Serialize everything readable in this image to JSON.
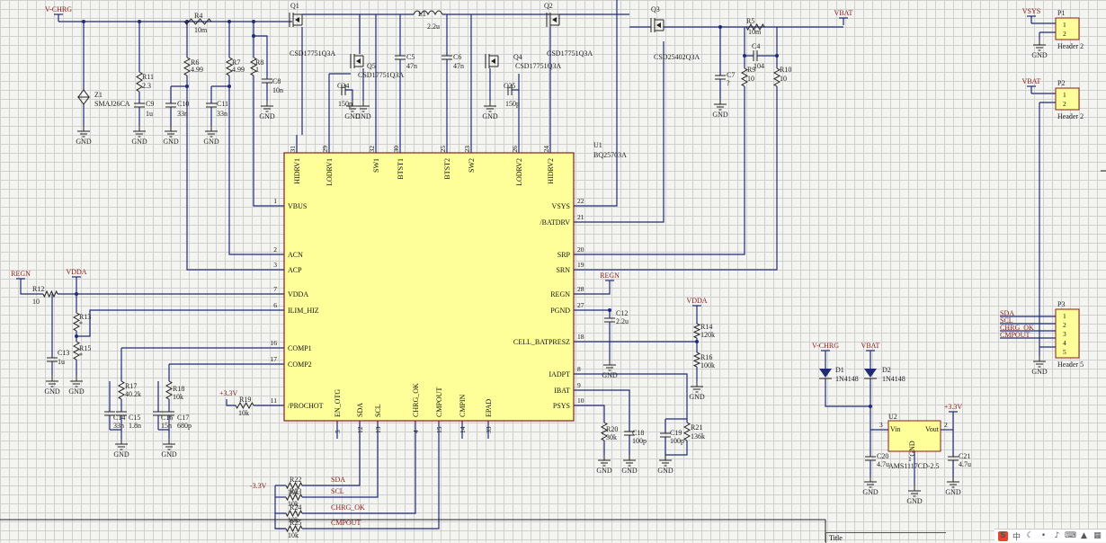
{
  "nets": {
    "vchrg": "V-CHRG",
    "vbat": "VBAT",
    "vsys": "VSYS",
    "regn": "REGN",
    "vdda": "VDDA",
    "v33": "+3.3V",
    "v33neg": "-3.3V",
    "gnd": "GND",
    "sda": "SDA",
    "scl": "SCL",
    "chrg_ok": "CHRG_OK",
    "cmpout": "CMPOUT"
  },
  "ic": {
    "designator": "U1",
    "part": "BQ25703A",
    "top_pins": [
      {
        "num": "31",
        "name": "HIDRV1"
      },
      {
        "num": "29",
        "name": "LODRV1"
      },
      {
        "num": "32",
        "name": "SW1"
      },
      {
        "num": "30",
        "name": "BTST1"
      },
      {
        "num": "25",
        "name": "BTST2"
      },
      {
        "num": "23",
        "name": "SW2"
      },
      {
        "num": "26",
        "name": "LODRV2"
      },
      {
        "num": "24",
        "name": "HIDRV2"
      }
    ],
    "left_pins": [
      {
        "num": "1",
        "name": "VBUS"
      },
      {
        "num": "2",
        "name": "ACN"
      },
      {
        "num": "3",
        "name": "ACP"
      },
      {
        "num": "7",
        "name": "VDDA"
      },
      {
        "num": "6",
        "name": "ILIM_HIZ"
      },
      {
        "num": "16",
        "name": "COMP1"
      },
      {
        "num": "17",
        "name": "COMP2"
      },
      {
        "num": "11",
        "name": "/PROCHOT"
      }
    ],
    "right_pins": [
      {
        "num": "22",
        "name": "VSYS"
      },
      {
        "num": "21",
        "name": "/BATDRV"
      },
      {
        "num": "20",
        "name": "SRP"
      },
      {
        "num": "19",
        "name": "SRN"
      },
      {
        "num": "28",
        "name": "REGN"
      },
      {
        "num": "27",
        "name": "PGND"
      },
      {
        "num": "18",
        "name": "CELL_BATPRESZ"
      },
      {
        "num": "8",
        "name": "IADPT"
      },
      {
        "num": "9",
        "name": "IBAT"
      },
      {
        "num": "10",
        "name": "PSYS"
      }
    ],
    "bottom_pins": [
      {
        "num": "5",
        "name": "EN_OTG"
      },
      {
        "num": "12",
        "name": "SDA"
      },
      {
        "num": "13",
        "name": "SCL"
      },
      {
        "num": "4",
        "name": "CHRG_OK"
      },
      {
        "num": "15",
        "name": "CMPOUT"
      },
      {
        "num": "14",
        "name": "CMPIN"
      },
      {
        "num": "33",
        "name": "EPAD"
      }
    ]
  },
  "components": {
    "q1": {
      "ref": "Q1",
      "val": "CSD17751Q3A"
    },
    "q2": {
      "ref": "Q2",
      "val": "CSD17751Q3A"
    },
    "q3": {
      "ref": "Q3",
      "val": "CSD25402Q3A"
    },
    "q4": {
      "ref": "Q4",
      "val": "CSD17751Q3A"
    },
    "q5": {
      "ref": "Q5",
      "val": "CSD17751Q3A"
    },
    "l1": {
      "ref": "L1",
      "val": "2.2u"
    },
    "r4": {
      "ref": "R4",
      "val": "10m"
    },
    "r5": {
      "ref": "R5",
      "val": "10m"
    },
    "z1": {
      "ref": "Z1",
      "val": "SMAJ26CA"
    },
    "r11": {
      "ref": "R11",
      "val": "2.3"
    },
    "c9": {
      "ref": "C9",
      "val": "1u"
    },
    "r6": {
      "ref": "R6",
      "val": "4.99"
    },
    "c10": {
      "ref": "C10",
      "val": "33n"
    },
    "r7": {
      "ref": "R7",
      "val": "4.99"
    },
    "c11": {
      "ref": "C11",
      "val": "33n"
    },
    "r8": {
      "ref": "R8",
      "val": "1"
    },
    "c8": {
      "ref": "C8",
      "val": "10n"
    },
    "c5": {
      "ref": "C5",
      "val": "47n"
    },
    "c6": {
      "ref": "C6",
      "val": "47n"
    },
    "c24": {
      "ref": "C24",
      "val": "150p"
    },
    "c25": {
      "ref": "C25",
      "val": "150p"
    },
    "c4": {
      "ref": "C4",
      "val": "104"
    },
    "c7": {
      "ref": "C7",
      "val": "?"
    },
    "r9": {
      "ref": "R9",
      "val": "10"
    },
    "r10": {
      "ref": "R10",
      "val": "10"
    },
    "r12": {
      "ref": "R12",
      "val": "10"
    },
    "r13": {
      "ref": "R13",
      "val": "*"
    },
    "r15": {
      "ref": "R15",
      "val": "*"
    },
    "c13": {
      "ref": "C13",
      "val": "1u"
    },
    "r17": {
      "ref": "R17",
      "val": "40.2k"
    },
    "c14": {
      "ref": "C14",
      "val": "33n"
    },
    "c15": {
      "ref": "C15",
      "val": "1.8n"
    },
    "r18": {
      "ref": "R18",
      "val": "10k"
    },
    "c16": {
      "ref": "C16",
      "val": "15n"
    },
    "c17": {
      "ref": "C17",
      "val": "680p"
    },
    "r19": {
      "ref": "R19",
      "val": "10k"
    },
    "c12": {
      "ref": "C12",
      "val": "2.2u"
    },
    "r14": {
      "ref": "R14",
      "val": "120k"
    },
    "r16": {
      "ref": "R16",
      "val": "100k"
    },
    "r20": {
      "ref": "R20",
      "val": "30k"
    },
    "c18": {
      "ref": "C18",
      "val": "100p"
    },
    "c19": {
      "ref": "C19",
      "val": "100p"
    },
    "r21": {
      "ref": "R21",
      "val": "136k"
    },
    "r22": {
      "ref": "R22",
      "val": "10k"
    },
    "r23": {
      "ref": "R23",
      "val": "10k"
    },
    "r24": {
      "ref": "R24",
      "val": "10k"
    },
    "r25": {
      "ref": "R25",
      "val": "10k"
    },
    "d1": {
      "ref": "D1",
      "val": "1N4148"
    },
    "d2": {
      "ref": "D2",
      "val": "1N4148"
    },
    "u2": {
      "ref": "U2",
      "val": "AMS1117CD-2.5",
      "vin": "Vin",
      "vout": "Vout",
      "gnd": "GND",
      "pin3": "3",
      "pin2": "2",
      "pin1": "1"
    },
    "c20": {
      "ref": "C20",
      "val": "4.7u"
    },
    "c21": {
      "ref": "C21",
      "val": "4.7u"
    }
  },
  "headers": {
    "p1": {
      "ref": "P1",
      "val": "Header 2",
      "pins": [
        "1",
        "2"
      ]
    },
    "p2": {
      "ref": "P2",
      "val": "Header 2",
      "pins": [
        "1",
        "2"
      ]
    },
    "p3": {
      "ref": "P3",
      "val": "Header 5",
      "pins": [
        "1",
        "2",
        "3",
        "4",
        "5"
      ]
    }
  },
  "title_block": {
    "label": "Title"
  },
  "taskbar": {
    "ime": "S",
    "lang": "中"
  },
  "colors": {
    "wire": "#1f2a7a",
    "ic_fill": "#ffff99",
    "ic_border": "#8b1a1a",
    "net_label": "#8b1a1a",
    "grid": "#cfcfcf",
    "bg": "#f4f4f0"
  }
}
